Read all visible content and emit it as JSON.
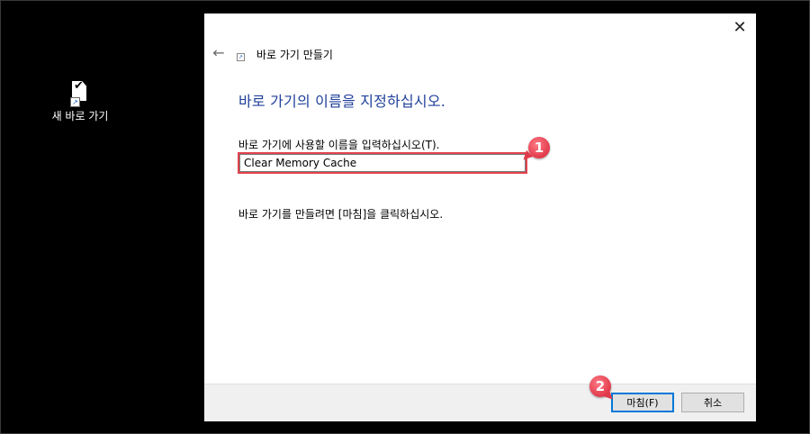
{
  "desktop": {
    "icon_label": "새 바로 가기",
    "icon_name": "shortcut-icon"
  },
  "dialog": {
    "window_title": "바로 가기 만들기",
    "heading": "바로 가기의 이름을 지정하십시오.",
    "field_label": "바로 가기에 사용할 이름을 입력하십시오(T).",
    "name_value": "Clear Memory Cache",
    "instruction": "바로 가기를 만들려면 [마침]을 클릭하십시오.",
    "finish_label": "마침(F)",
    "cancel_label": "취소",
    "close_glyph": "✕",
    "back_glyph": "←",
    "heading_color": "#1f3f9a"
  },
  "callouts": {
    "one": "1",
    "two": "2",
    "color": "#e13a4b"
  }
}
